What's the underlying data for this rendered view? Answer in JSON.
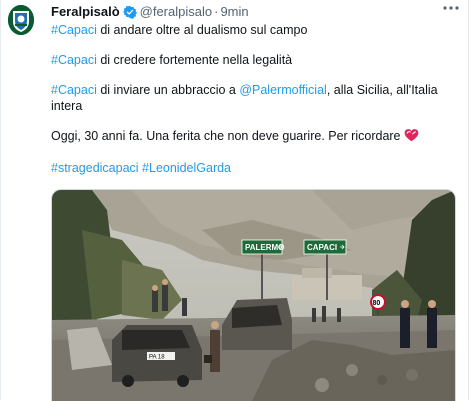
{
  "author": {
    "name": "Feralpisalò",
    "handle": "@feralpisalo",
    "separator": "·",
    "time": "9min"
  },
  "icons": {
    "avatar": "club-crest-icon",
    "verified": "verified-badge-icon",
    "more": "more-options-icon",
    "heart": "heart-icon"
  },
  "colors": {
    "link": "#1d9bf0",
    "verified": "#1d9bf0",
    "heart": "#e0245e",
    "avatar": "#0a5a34"
  },
  "tweet": {
    "p1": {
      "tag": "#Capaci",
      "text": " di andare oltre al dualismo sul campo"
    },
    "p2": {
      "tag": "#Capaci",
      "text": " di credere fortemente nella legalità"
    },
    "p3": {
      "tag": "#Capaci",
      "text_a": " di inviare un abbraccio a ",
      "mention": "@Palermofficial",
      "text_b": ", alla Sicilia, all'Italia intera"
    },
    "p4": {
      "text": "Oggi, 30 anni fa. Una ferita che non deve guarire. Per ricordare "
    },
    "p5": {
      "tag1": "#stragedicapaci",
      "tag2": "#LeonidelGarda"
    }
  },
  "photo": {
    "sign_left": "PALERMO",
    "sign_right": "CAPACI",
    "speed_sign": "80",
    "plate": "PA 18"
  }
}
